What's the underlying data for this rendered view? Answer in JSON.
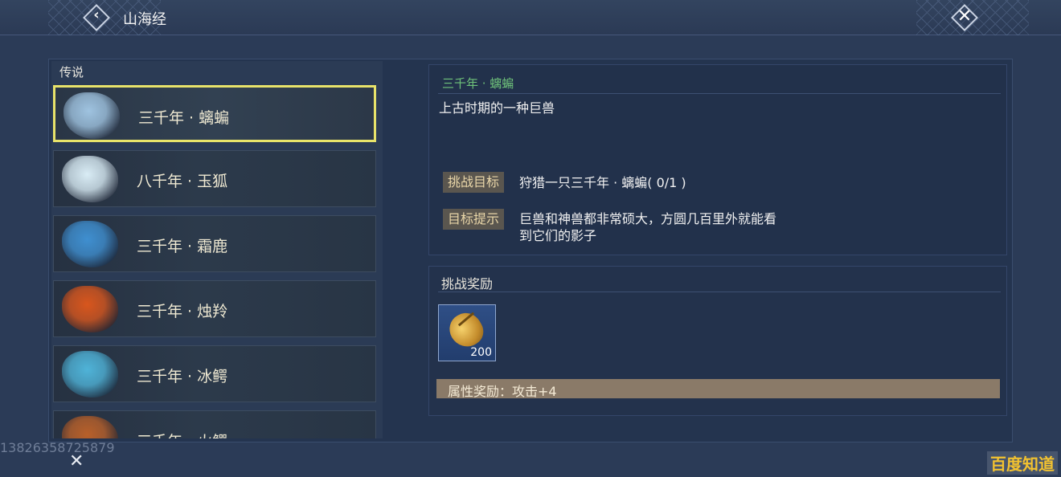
{
  "header": {
    "title": "山海经",
    "back_glyph": "‹",
    "close_glyph": "✕"
  },
  "category": "传说",
  "beasts": [
    {
      "name": "三千年 · 螭蝙",
      "selected": true,
      "icon": "silver-dragon-head",
      "color": "#9fc3e0"
    },
    {
      "name": "八千年 · 玉狐",
      "selected": false,
      "icon": "white-fox-head",
      "color": "#d9ecf5"
    },
    {
      "name": "三千年 · 霜鹿",
      "selected": false,
      "icon": "frost-beast-head",
      "color": "#3f8fd0"
    },
    {
      "name": "三千年 · 烛羚",
      "selected": false,
      "icon": "fire-beast-head",
      "color": "#d8561d"
    },
    {
      "name": "三千年 · 冰鳄",
      "selected": false,
      "icon": "ice-beast-head",
      "color": "#4fb3d8"
    },
    {
      "name": "三千年 · 火鳄",
      "selected": false,
      "icon": "ember-beast-head",
      "color": "#b8602a"
    }
  ],
  "detail": {
    "title": "三千年 · 螭蝙",
    "description": "上古时期的一种巨兽",
    "goal_tag": "挑战目标",
    "goal_text": "狩猎一只三千年 · 螭蝙( 0/1 )",
    "hint_tag": "目标提示",
    "hint_line1": "巨兽和神兽都非常硕大，方圆几百里外就能看",
    "hint_line2": "到它们的影子"
  },
  "reward": {
    "label": "挑战奖励",
    "item_icon": "golden-shell-icon",
    "item_count": "200",
    "attribute": "属性奖励：攻击+4"
  },
  "footer": {
    "watermark_number": "13826358725879",
    "close_glyph": "✕",
    "brand": "百度知道"
  },
  "colors": {
    "selected_border": "#e8e36a",
    "title_green": "#6fc27a",
    "tag_bg": "#5a564f",
    "attr_bar": "#8a7a68"
  }
}
